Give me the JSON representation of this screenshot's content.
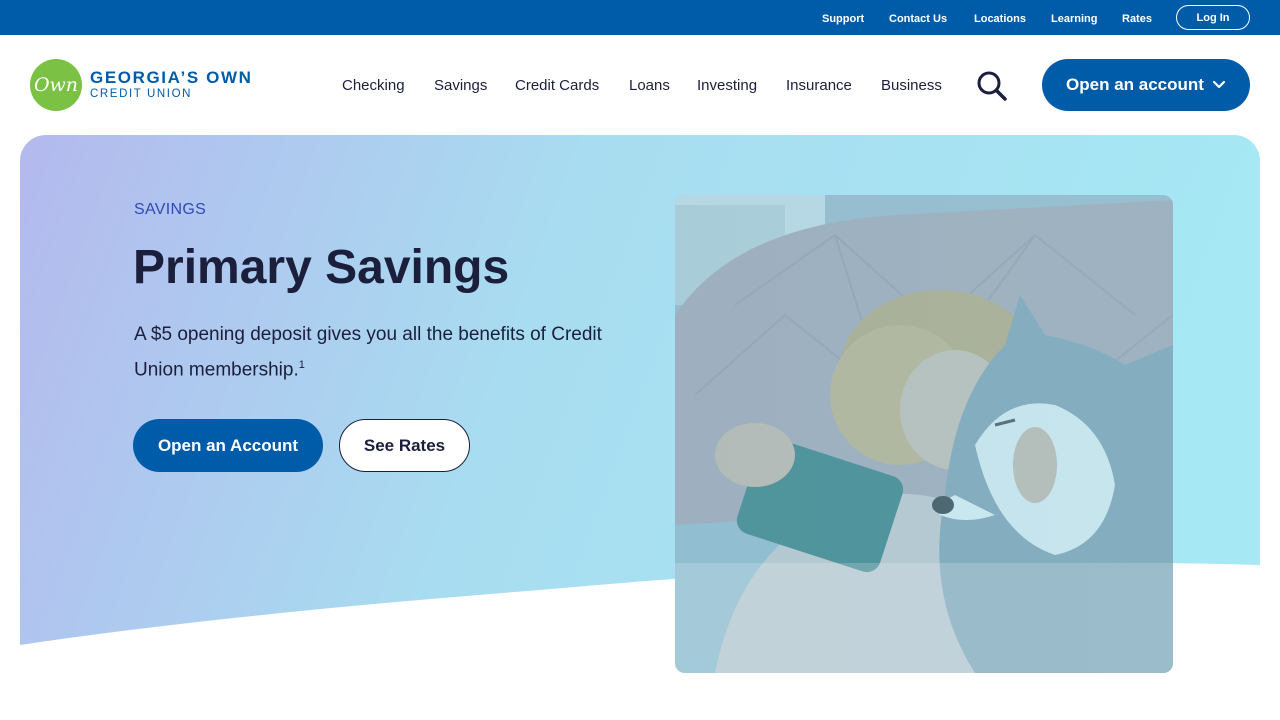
{
  "utility_nav": {
    "support": "Support",
    "contact": "Contact Us",
    "locations": "Locations",
    "learning": "Learning",
    "rates": "Rates",
    "login": "Log In"
  },
  "brand": {
    "mark": "Own",
    "line1": "GEORGIA’S OWN",
    "line2": "CREDIT UNION",
    "color_primary": "#005ca9",
    "color_green": "#7bc143"
  },
  "main_nav": {
    "checking": "Checking",
    "savings": "Savings",
    "credit_cards": "Credit Cards",
    "loans": "Loans",
    "investing": "Investing",
    "insurance": "Insurance",
    "business": "Business",
    "cta": "Open an account"
  },
  "hero": {
    "eyebrow": "SAVINGS",
    "title": "Primary Savings",
    "body": "A $5 opening deposit gives you all the benefits of Credit Union membership.",
    "footnote": "1",
    "primary_button": "Open an Account",
    "secondary_button": "See Rates"
  }
}
